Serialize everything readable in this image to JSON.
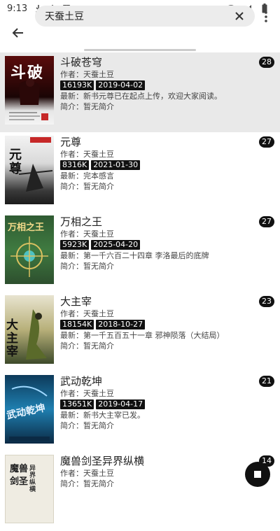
{
  "status_bar": {
    "time": "9:13"
  },
  "search": {
    "query": "天蚕土豆"
  },
  "books": [
    {
      "title": "斗破苍穹",
      "author_label": "作者：",
      "author": "天蚕土豆",
      "size": "16193K",
      "date": "2019-04-02",
      "latest_label": "最新：",
      "latest": "新书元尊已在起点上传，欢迎大家阅读。",
      "intro_label": "简介：",
      "intro": "暂无简介",
      "count": "28",
      "highlighted": true
    },
    {
      "title": "元尊",
      "author_label": "作者：",
      "author": "天蚕土豆",
      "size": "8316K",
      "date": "2021-01-30",
      "latest_label": "最新：",
      "latest": "完本感言",
      "intro_label": "简介：",
      "intro": "暂无简介",
      "count": "27",
      "highlighted": false
    },
    {
      "title": "万相之王",
      "author_label": "作者：",
      "author": "天蚕土豆",
      "size": "5923K",
      "date": "2025-04-20",
      "latest_label": "最新：",
      "latest": "第一千六百二十四章 李洛最后的底牌",
      "intro_label": "简介：",
      "intro": "暂无简介",
      "count": "27",
      "highlighted": false
    },
    {
      "title": "大主宰",
      "author_label": "作者：",
      "author": "天蚕土豆",
      "size": "18154K",
      "date": "2018-10-27",
      "latest_label": "最新：",
      "latest": "第一千五百五十一章 邪神陨落（大结局）",
      "intro_label": "简介：",
      "intro": "暂无简介",
      "count": "23",
      "highlighted": false
    },
    {
      "title": "武动乾坤",
      "author_label": "作者：",
      "author": "天蚕土豆",
      "size": "13651K",
      "date": "2019-04-17",
      "latest_label": "最新：",
      "latest": "新书大主宰已发。",
      "intro_label": "简介：",
      "intro": "暂无简介",
      "count": "21",
      "highlighted": false
    },
    {
      "title": "魔兽剑圣异界纵横",
      "author_label": "作者：",
      "author": "天蚕土豆",
      "size": "",
      "date": "",
      "latest_label": "",
      "latest": "",
      "intro_label": "简介：",
      "intro": "暂无简介",
      "count": "14",
      "highlighted": false
    }
  ],
  "covers": {
    "c0": "斗破",
    "c1": "元尊",
    "c2": "万相之王",
    "c3": "大主宰",
    "c4": "武动乾坤",
    "c5a": "魔兽",
    "c5b": "剑圣",
    "c5c": "异界纵横"
  },
  "colors": {
    "highlight": "#e9e9e9",
    "tag_bg": "#111111",
    "badge_bg": "#111111"
  }
}
